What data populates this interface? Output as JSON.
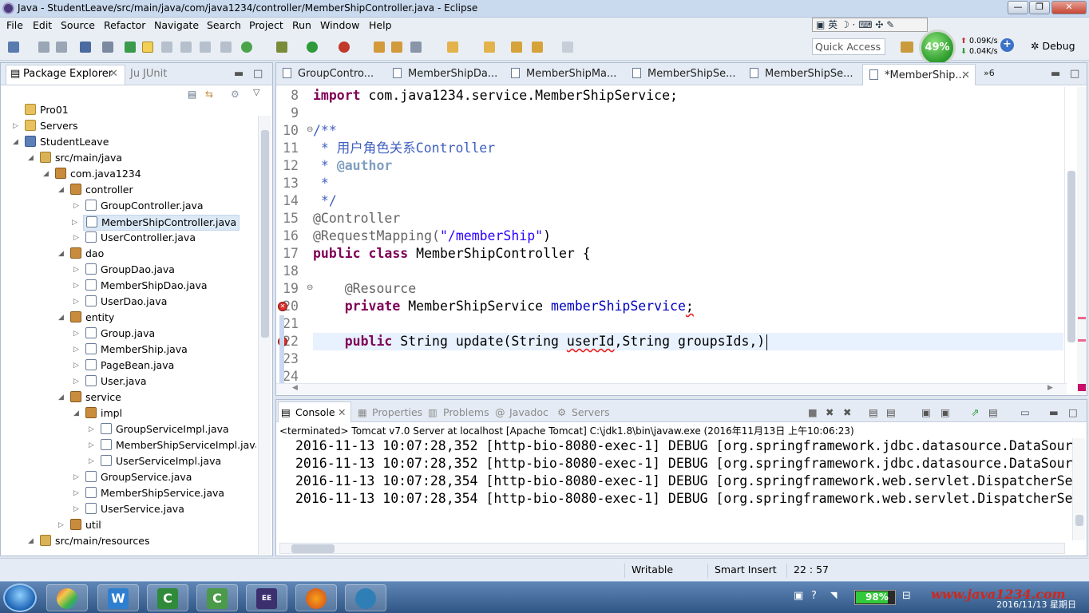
{
  "window": {
    "title": "Java - StudentLeave/src/main/java/com/java1234/controller/MemberShipController.java - Eclipse"
  },
  "menu": [
    "File",
    "Edit",
    "Source",
    "Refactor",
    "Navigate",
    "Search",
    "Project",
    "Run",
    "Window",
    "Help"
  ],
  "ime": {
    "text": "英"
  },
  "quick_access": {
    "placeholder": "Quick Access"
  },
  "perf": {
    "cpu": "49%",
    "up": "0.09K/s",
    "down": "0.04K/s"
  },
  "perspective": {
    "debug": "Debug"
  },
  "left_tabs": {
    "package_explorer": "Package Explorer",
    "junit": "JUnit"
  },
  "tree": [
    {
      "label": "Pro01",
      "depth": 0,
      "icon": "folder"
    },
    {
      "label": "Servers",
      "depth": 0,
      "icon": "folder"
    },
    {
      "label": "StudentLeave",
      "depth": 0,
      "icon": "project"
    },
    {
      "label": "src/main/java",
      "depth": 1,
      "icon": "source"
    },
    {
      "label": "com.java1234",
      "depth": 2,
      "icon": "package"
    },
    {
      "label": "controller",
      "depth": 3,
      "icon": "package"
    },
    {
      "label": "GroupController.java",
      "depth": 4,
      "icon": "java"
    },
    {
      "label": "MemberShipController.java",
      "depth": 4,
      "icon": "java"
    },
    {
      "label": "UserController.java",
      "depth": 4,
      "icon": "java"
    },
    {
      "label": "dao",
      "depth": 3,
      "icon": "package"
    },
    {
      "label": "GroupDao.java",
      "depth": 4,
      "icon": "java"
    },
    {
      "label": "MemberShipDao.java",
      "depth": 4,
      "icon": "java"
    },
    {
      "label": "UserDao.java",
      "depth": 4,
      "icon": "java"
    },
    {
      "label": "entity",
      "depth": 3,
      "icon": "package"
    },
    {
      "label": "Group.java",
      "depth": 4,
      "icon": "java"
    },
    {
      "label": "MemberShip.java",
      "depth": 4,
      "icon": "java"
    },
    {
      "label": "PageBean.java",
      "depth": 4,
      "icon": "java"
    },
    {
      "label": "User.java",
      "depth": 4,
      "icon": "java"
    },
    {
      "label": "service",
      "depth": 3,
      "icon": "package"
    },
    {
      "label": "impl",
      "depth": 4,
      "icon": "package"
    },
    {
      "label": "GroupServiceImpl.java",
      "depth": 5,
      "icon": "java"
    },
    {
      "label": "MemberShipServiceImpl.java",
      "depth": 5,
      "icon": "java"
    },
    {
      "label": "UserServiceImpl.java",
      "depth": 5,
      "icon": "java"
    },
    {
      "label": "GroupService.java",
      "depth": 4,
      "icon": "java"
    },
    {
      "label": "MemberShipService.java",
      "depth": 4,
      "icon": "java"
    },
    {
      "label": "UserService.java",
      "depth": 4,
      "icon": "java"
    },
    {
      "label": "util",
      "depth": 3,
      "icon": "package"
    },
    {
      "label": "src/main/resources",
      "depth": 1,
      "icon": "source"
    }
  ],
  "editor_tabs": [
    "GroupContro...",
    "MemberShipDa...",
    "MemberShipMa...",
    "MemberShipSe...",
    "MemberShipSe...",
    "*MemberShip..."
  ],
  "editor_overflow": "6",
  "code": {
    "line_numbers": [
      "8",
      "9",
      "10",
      "11",
      "12",
      "13",
      "14",
      "15",
      "16",
      "17",
      "18",
      "19",
      "20",
      "21",
      "22",
      "23",
      "24"
    ],
    "l8_kw": "import",
    "l8_rest": " com.java1234.service.MemberShipService;",
    "l10": "/**",
    "l11": " * 用户角色关系Controller",
    "l12_star": " * ",
    "l12_tag": "@author",
    "l13": " *",
    "l14": " */",
    "l15": "@Controller",
    "l16_an": "@RequestMapping(",
    "l16_str": "\"/memberShip\"",
    "l16_end": ")",
    "l17_kw": "public class",
    "l17_rest": " MemberShipController {",
    "l19": "    @Resource",
    "l20_kw": "    private",
    "l20_type": " MemberShipService ",
    "l20_field": "memberShipService",
    "l20_semi": ";",
    "l22_kw": "    public",
    "l22_a": " String update(String ",
    "l22_err": "userId",
    "l22_b": ",String groupsIds,)"
  },
  "console_tabs": {
    "console": "Console",
    "properties": "Properties",
    "problems": "Problems",
    "javadoc": "Javadoc",
    "servers": "Servers"
  },
  "console_info": "<terminated> Tomcat v7.0 Server at localhost [Apache Tomcat] C:\\jdk1.8\\bin\\javaw.exe (2016年11月13日 上午10:06:23)",
  "console_lines": [
    "2016-11-13 10:07:28,352 [http-bio-8080-exec-1] DEBUG [org.springframework.jdbc.datasource.DataSour",
    "2016-11-13 10:07:28,352 [http-bio-8080-exec-1] DEBUG [org.springframework.jdbc.datasource.DataSour",
    "2016-11-13 10:07:28,354 [http-bio-8080-exec-1] DEBUG [org.springframework.web.servlet.DispatcherSe",
    "2016-11-13 10:07:28,354 [http-bio-8080-exec-1] DEBUG [org.springframework.web.servlet.DispatcherSe"
  ],
  "status": {
    "writable": "Writable",
    "insert": "Smart Insert",
    "position": "22 : 57"
  },
  "taskbar": {
    "battery": "98%",
    "watermark": "www.java1234.com",
    "date": "2016/11/13 星期日"
  },
  "colors": {
    "keyword": "#7f0055",
    "comment": "#3f5fbf",
    "string": "#2a00ff",
    "field": "#0000c0",
    "current_line": "#e8f2fe"
  }
}
